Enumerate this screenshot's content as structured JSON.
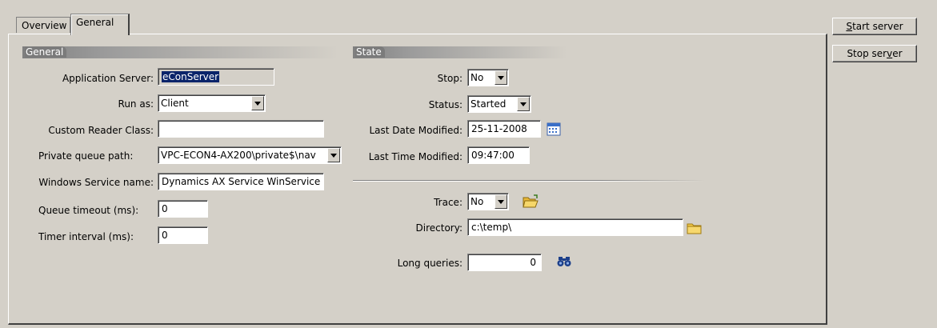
{
  "tabs": [
    {
      "label": "Overview",
      "active": false
    },
    {
      "label": "General",
      "active": true
    }
  ],
  "general": {
    "header": "General",
    "application_server": {
      "label": "Application Server:",
      "value": "eConServer"
    },
    "run_as": {
      "label": "Run as:",
      "value": "Client"
    },
    "custom_reader_class": {
      "label": "Custom Reader Class:",
      "value": ""
    },
    "private_queue_path": {
      "label": "Private queue path:",
      "value": "VPC-ECON4-AX200\\private$\\nav"
    },
    "windows_service_name": {
      "label": "Windows Service name:",
      "value": "Dynamics AX Service WinService"
    },
    "queue_timeout": {
      "label": "Queue timeout (ms):",
      "value": "0"
    },
    "timer_interval": {
      "label": "Timer interval (ms):",
      "value": "0"
    }
  },
  "state": {
    "header": "State",
    "stop": {
      "label": "Stop:",
      "value": "No"
    },
    "status": {
      "label": "Status:",
      "value": "Started"
    },
    "last_date_modified": {
      "label": "Last Date Modified:",
      "value": "25-11-2008"
    },
    "last_time_modified": {
      "label": "Last Time Modified:",
      "value": "09:47:00"
    },
    "trace": {
      "label": "Trace:",
      "value": "No"
    },
    "directory": {
      "label": "Directory:",
      "value": "c:\\temp\\"
    },
    "long_queries": {
      "label": "Long queries:",
      "value": "0"
    }
  },
  "buttons": {
    "start_server_prefix": "S",
    "start_server_rest": "tart server",
    "stop_server_prefix": "Stop ser",
    "stop_server_key": "v",
    "stop_server_rest": "er"
  },
  "icons": {
    "calendar": "calendar-icon",
    "open_folder": "open-folder-icon",
    "folder": "folder-icon",
    "find": "binoculars-icon"
  }
}
